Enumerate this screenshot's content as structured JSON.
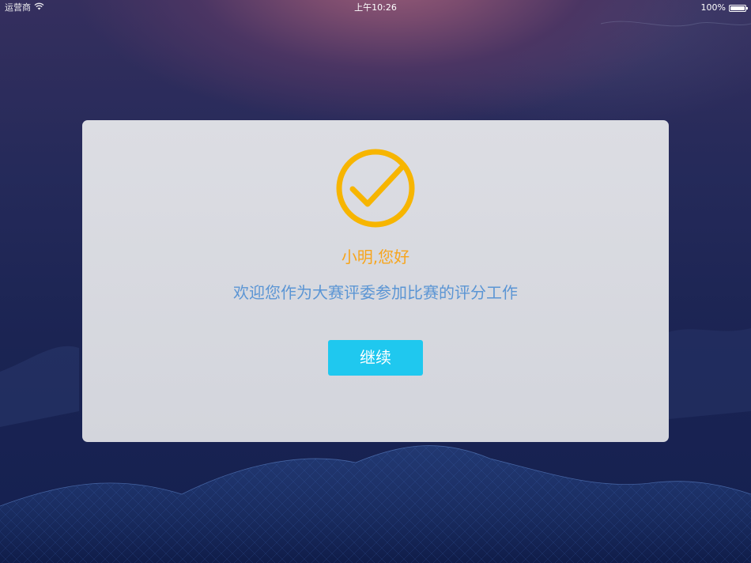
{
  "status_bar": {
    "carrier": "运营商",
    "wifi_icon": "wifi-icon",
    "time": "上午10:26",
    "battery_percent": "100%",
    "battery_level": 1.0,
    "battery_icon": "battery-icon"
  },
  "dialog": {
    "icon": "checkmark-circle-icon",
    "icon_color": "#f7b500",
    "greeting": "小明,您好",
    "greeting_color": "#f7a51c",
    "welcome": "欢迎您作为大赛评委参加比赛的评分工作",
    "welcome_color": "#5b95d4",
    "continue_label": "继续",
    "button_color": "#1fc8ef"
  }
}
